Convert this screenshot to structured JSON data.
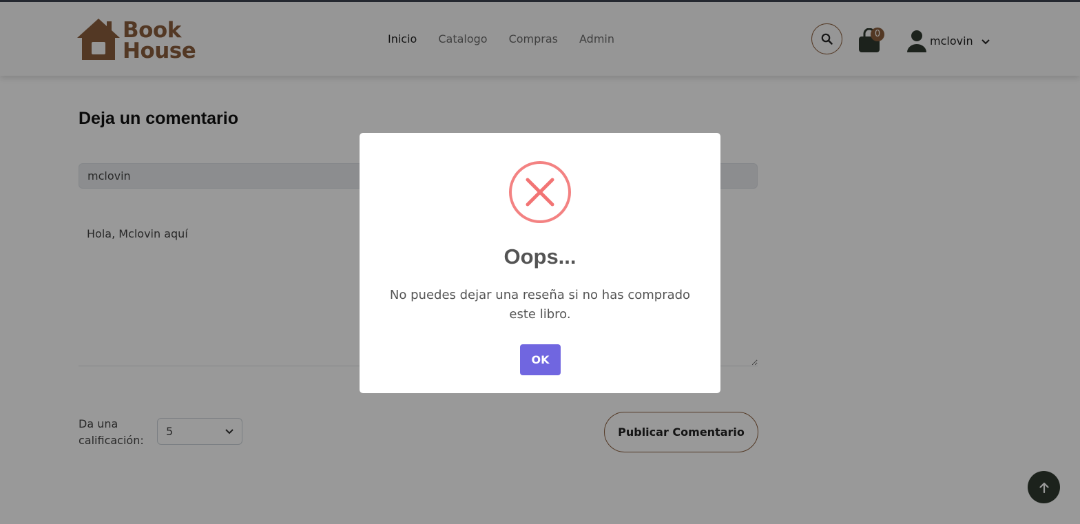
{
  "brand": {
    "line1": "Book",
    "line2": "House",
    "color": "#8b5e3c",
    "icon": "house-icon"
  },
  "nav": {
    "items": [
      "Inicio",
      "Catalogo",
      "Compras",
      "Admin"
    ],
    "active": "Inicio"
  },
  "cart": {
    "count": "0"
  },
  "user": {
    "name": "mclovin"
  },
  "review_form": {
    "title": "Deja un comentario",
    "name_value": "mclovin",
    "comment_value": "Hola, Mclovin aquí",
    "rating_label": "Da una calificación:",
    "rating_value": "5",
    "submit_label": "Publicar Comentario"
  },
  "modal": {
    "title": "Oops...",
    "message": "No puedes dejar una reseña si no has comprado este libro.",
    "confirm_label": "OK",
    "icon": "error-x-icon",
    "icon_color": "#f27474",
    "confirm_color": "#7066e0"
  }
}
